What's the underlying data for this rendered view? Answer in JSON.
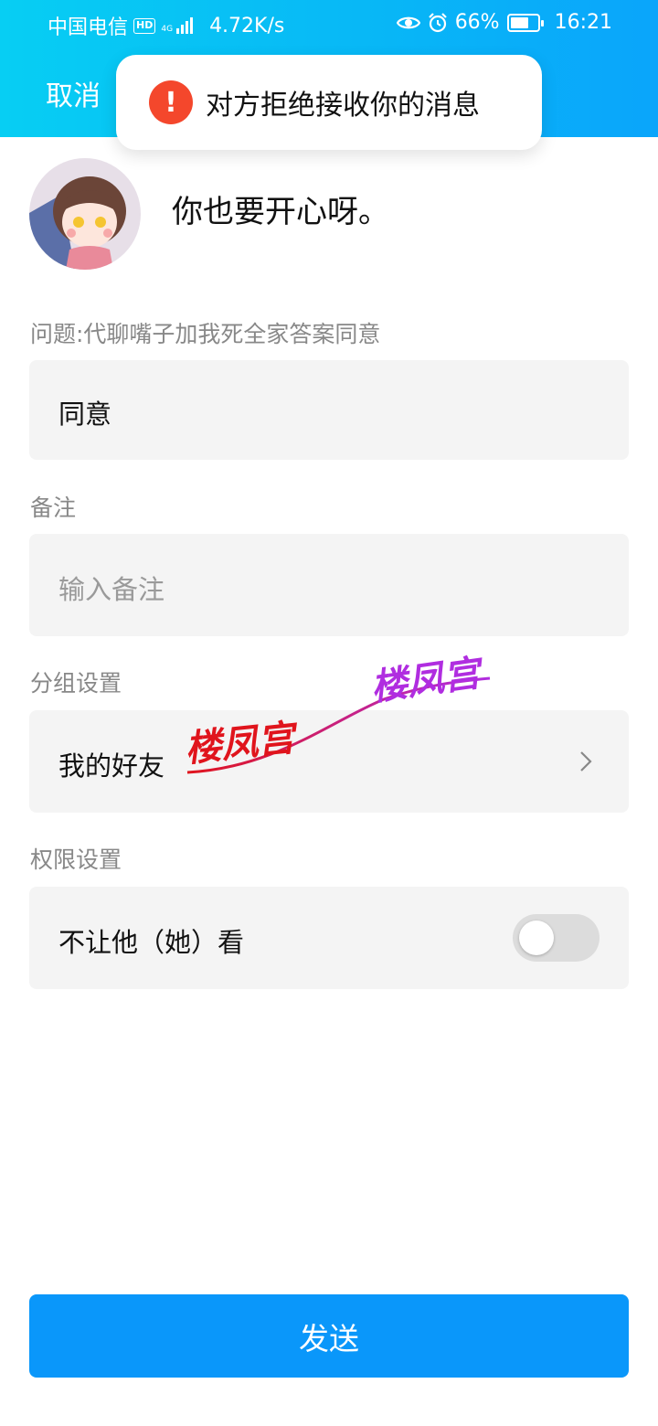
{
  "status_bar": {
    "carrier": "中国电信",
    "hd": "HD",
    "network": "4G",
    "speed": "4.72K/s",
    "battery_percent": "66%",
    "battery_level": 0.66,
    "time": "16:21"
  },
  "header": {
    "cancel_label": "取消"
  },
  "toast": {
    "icon": "!",
    "message": "对方拒绝接收你的消息"
  },
  "profile": {
    "nickname": "你也要开心呀。"
  },
  "question": {
    "label": "问题:代聊嘴子加我死全家答案同意",
    "answer": "同意"
  },
  "remark": {
    "label": "备注",
    "placeholder": "输入备注"
  },
  "group": {
    "label": "分组设置",
    "value": "我的好友"
  },
  "permission": {
    "label": "权限设置",
    "option": "不让他（她）看",
    "enabled": false
  },
  "watermark": {
    "text_left": "楼凤宫",
    "text_right": "楼凤宫"
  },
  "send_label": "发送",
  "colors": {
    "header_gradient_start": "#07cef3",
    "header_gradient_end": "#0aa5fb",
    "send_button": "#0a97fa",
    "toast_icon": "#f4472c",
    "card_bg": "#f4f4f4"
  }
}
